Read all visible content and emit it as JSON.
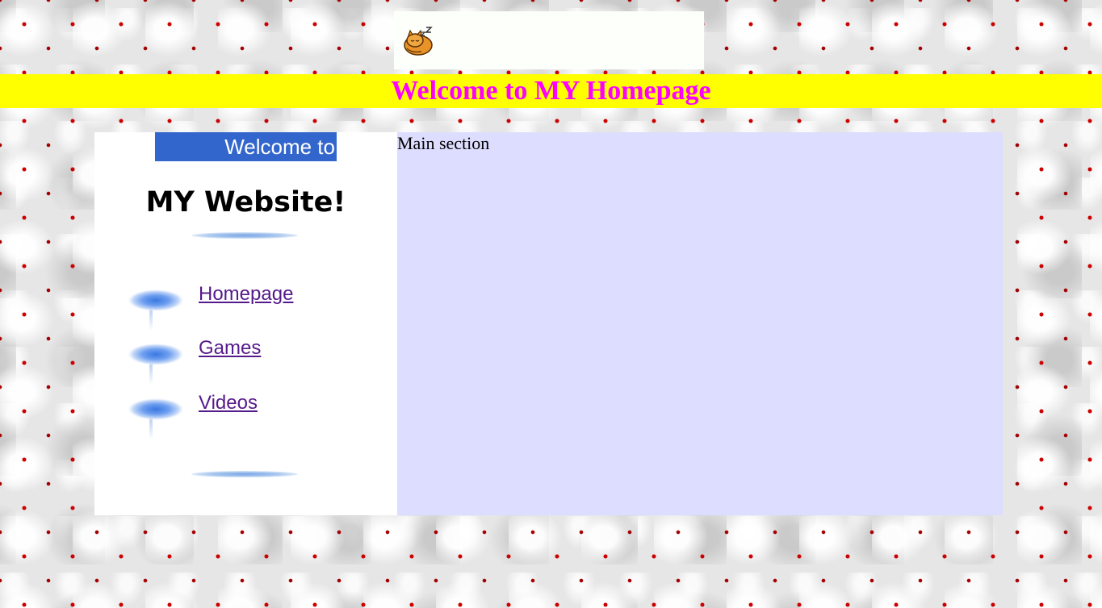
{
  "header": {
    "logo_icon": "sleeping-cat-icon",
    "title": "Welcome to MY Homepage",
    "banner_color": "#ffff00",
    "title_color": "#ff00ff"
  },
  "sidebar": {
    "welcome_text": "Welcome to",
    "welcome_bg_color": "#3366cc",
    "heading": "MY Website!",
    "nav_items": [
      {
        "label": "Homepage",
        "icon": "blue-orb-icon"
      },
      {
        "label": "Games",
        "icon": "blue-orb-icon"
      },
      {
        "label": "Videos",
        "icon": "blue-orb-icon"
      }
    ],
    "link_color": "#551a8b"
  },
  "main": {
    "label": "Main section",
    "bg_color": "#ddddff"
  },
  "page": {
    "background_pattern": "white-clouds-with-red-hearts"
  }
}
